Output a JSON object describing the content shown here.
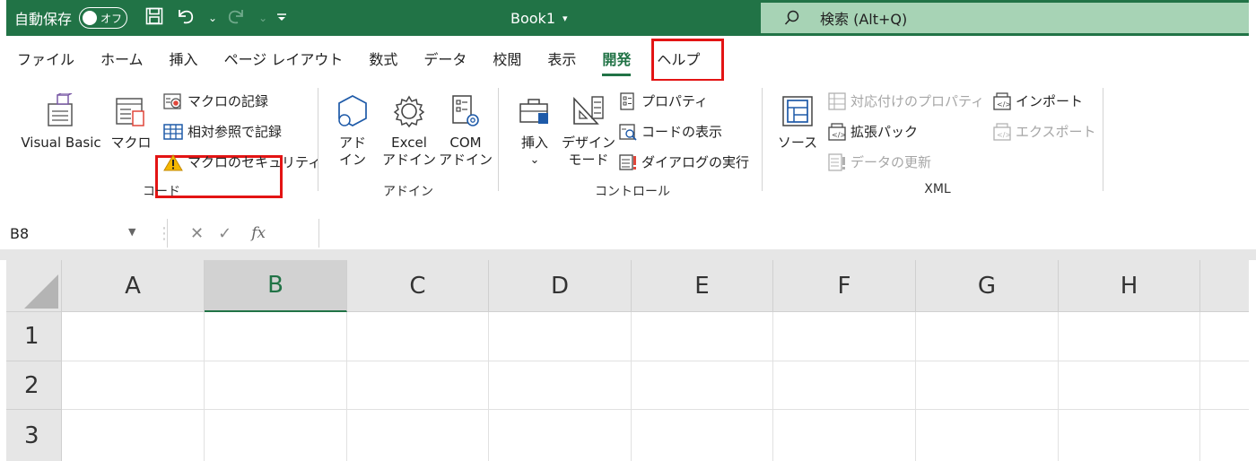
{
  "titlebar": {
    "autosave_label": "自動保存",
    "autosave_state": "オフ",
    "title": "Book1",
    "title_caret": "▾",
    "search_text": "検索 (Alt+Q)"
  },
  "tabs": [
    {
      "label": "ファイル"
    },
    {
      "label": "ホーム"
    },
    {
      "label": "挿入"
    },
    {
      "label": "ページ レイアウト"
    },
    {
      "label": "数式"
    },
    {
      "label": "データ"
    },
    {
      "label": "校閲"
    },
    {
      "label": "表示"
    },
    {
      "label": "開発"
    },
    {
      "label": "ヘルプ"
    }
  ],
  "ribbon": {
    "code": {
      "label": "コード",
      "visual_basic": "Visual Basic",
      "macro": "マクロ",
      "record_macro": "マクロの記録",
      "relative_ref": "相対参照で記録",
      "macro_security": "マクロのセキュリティ"
    },
    "addins": {
      "label": "アドイン",
      "addins_1": "アド",
      "addins_2": "イン",
      "excel_addins_1": "Excel",
      "excel_addins_2": "アドイン",
      "com_addins_1": "COM",
      "com_addins_2": "アドイン"
    },
    "controls": {
      "label": "コントロール",
      "insert": "挿入",
      "insert_caret": "⌄",
      "design_mode_1": "デザイン",
      "design_mode_2": "モード",
      "properties": "プロパティ",
      "view_code": "コードの表示",
      "run_dialog": "ダイアログの実行"
    },
    "xml": {
      "label": "XML",
      "source": "ソース",
      "map_properties": "対応付けのプロパティ",
      "expansion_packs": "拡張パック",
      "refresh_data": "データの更新",
      "import": "インポート",
      "export": "エクスポート"
    }
  },
  "formula_bar": {
    "name_box": "B8",
    "cancel": "✕",
    "enter": "✓",
    "fx": "fx",
    "value": ""
  },
  "sheet": {
    "columns": [
      "A",
      "B",
      "C",
      "D",
      "E",
      "F",
      "G",
      "H"
    ],
    "rows": [
      "1",
      "2",
      "3"
    ],
    "selected_column": "B"
  },
  "colors": {
    "brand_green": "#217346",
    "highlight_red": "#e31414",
    "search_bg": "#a7d3b5"
  }
}
